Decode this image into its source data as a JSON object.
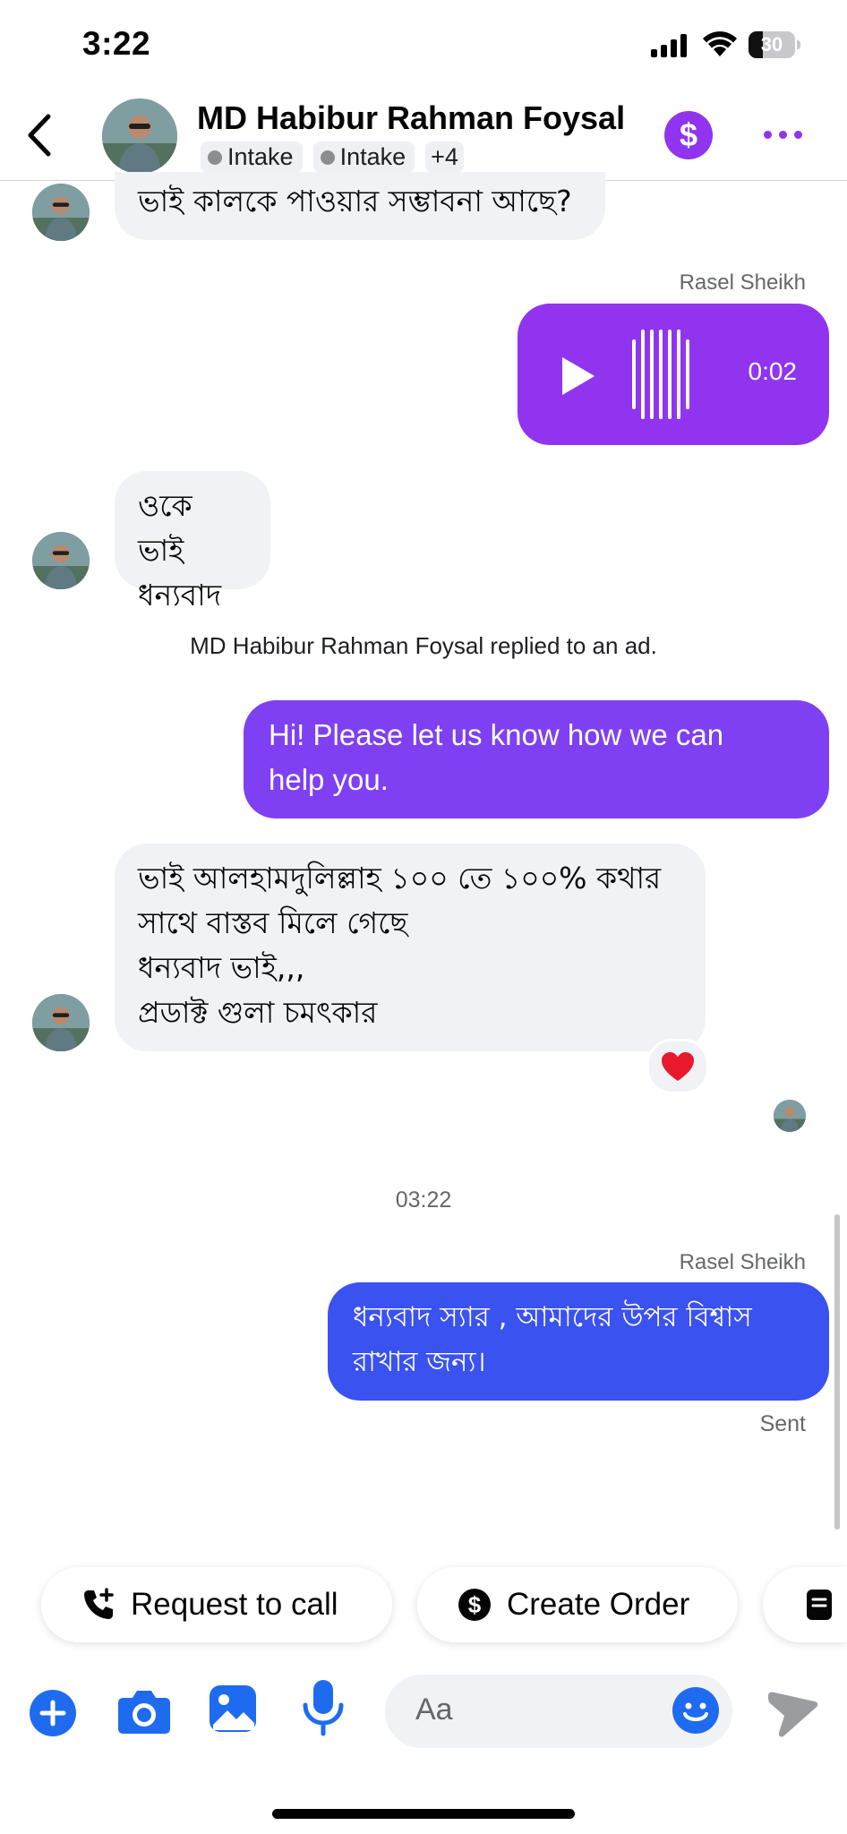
{
  "status_bar": {
    "time": "3:22",
    "battery": "30",
    "battery_level": 0.3
  },
  "header": {
    "name": "MD Habibur Rahman Foysal",
    "tags": [
      "Intake",
      "Intake"
    ],
    "more_tags": "+4",
    "dollar_symbol": "$"
  },
  "messages": {
    "in_1": "ভাই কালকে পাওয়ার সম্ভাবনা আছে?",
    "sender_1": "Rasel Sheikh",
    "voice_duration": "0:02",
    "in_2_line1": "ওকে ভাই",
    "in_2_line2": "ধন্যবাদ",
    "system_note": "MD Habibur Rahman Foysal replied to an ad.",
    "out_greeting_line1": "Hi! Please let us know how we can",
    "out_greeting_line2": "help you.",
    "in_3_line1": "ভাই আলহামদুলিল্লাহ ১০০ তে ১০০% কথার",
    "in_3_line2": "সাথে বাস্তব মিলে গেছে",
    "in_3_line3": "ধন্যবাদ ভাই,,,",
    "in_3_line4": "প্রডাক্ট গুলা চমৎকার",
    "reaction": "❤",
    "timestamp": "03:22",
    "sender_2": "Rasel Sheikh",
    "out_reply_line1": "ধন্যবাদ স্যার , আমাদের উপর বিশ্বাস",
    "out_reply_line2": "রাখার জন্য।",
    "status": "Sent"
  },
  "quick_actions": {
    "request_call": "Request to call",
    "create_order": "Create Order"
  },
  "composer": {
    "placeholder": "Aa"
  },
  "colors": {
    "accent_purple": "#9134ef",
    "greeting_bubble": "#7f3ff2",
    "reply_bubble": "#3a52f0",
    "icon_blue": "#1f6bf0",
    "incoming_bubble": "#f0f2f5"
  }
}
